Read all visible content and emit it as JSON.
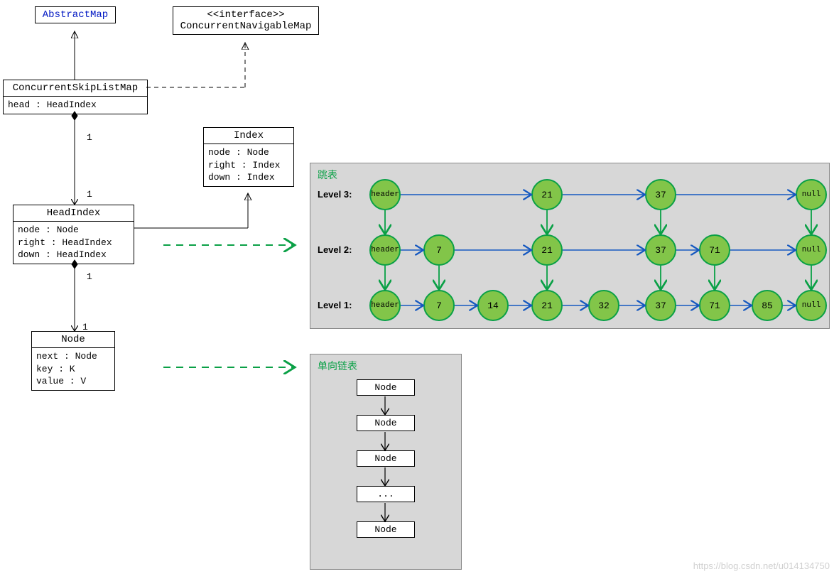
{
  "uml": {
    "abstractMap": "AbstractMap",
    "interfaceStereo": "<<interface>>",
    "concurrentNavMap": "ConcurrentNavigableMap",
    "cslMap": {
      "title": "ConcurrentSkipListMap",
      "attrs": [
        "head : HeadIndex"
      ]
    },
    "index": {
      "title": "Index",
      "attrs": [
        "node : Node",
        "right : Index",
        "down : Index"
      ]
    },
    "headIndex": {
      "title": "HeadIndex",
      "attrs": [
        "node : Node",
        "right : HeadIndex",
        "down : HeadIndex"
      ]
    },
    "node": {
      "title": "Node",
      "attrs": [
        "next : Node",
        "key : K",
        "value : V"
      ]
    },
    "mult": "1"
  },
  "skipList": {
    "title": "跳表",
    "levels": [
      "Level 3:",
      "Level 2:",
      "Level 1:"
    ],
    "rows": [
      [
        "header",
        "21",
        "37",
        "null"
      ],
      [
        "header",
        "7",
        "21",
        "37",
        "71",
        "null"
      ],
      [
        "header",
        "7",
        "14",
        "21",
        "32",
        "37",
        "71",
        "85",
        "null"
      ]
    ]
  },
  "linkedList": {
    "title": "单向链表",
    "items": [
      "Node",
      "Node",
      "Node",
      "...",
      "Node"
    ]
  },
  "watermark": "https://blog.csdn.net/u014134750"
}
